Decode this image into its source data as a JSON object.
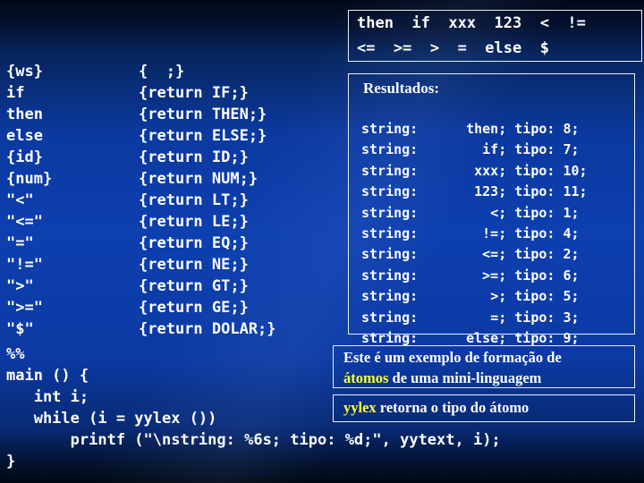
{
  "token_box": {
    "line1": "then  if  xxx  123  <  !=",
    "line2": "<=  >=  >  =  else  $"
  },
  "code_rules": [
    {
      "pattern": "{ws}",
      "action": "{  ;}"
    },
    {
      "pattern": "if",
      "action": "{return IF;}"
    },
    {
      "pattern": "then",
      "action": "{return THEN;}"
    },
    {
      "pattern": "else",
      "action": "{return ELSE;}"
    },
    {
      "pattern": "{id}",
      "action": "{return ID;}"
    },
    {
      "pattern": "{num}",
      "action": "{return NUM;}"
    },
    {
      "pattern": "\"<\"",
      "action": "{return LT;}"
    },
    {
      "pattern": "\"<=\"",
      "action": "{return LE;}"
    },
    {
      "pattern": "\"=\"",
      "action": "{return EQ;}"
    },
    {
      "pattern": "\"!=\"",
      "action": "{return NE;}"
    },
    {
      "pattern": "\">\"",
      "action": "{return GT;}"
    },
    {
      "pattern": "\">=\"",
      "action": "{return GE;}"
    },
    {
      "pattern": "\"$\"",
      "action": "{return DOLAR;}"
    }
  ],
  "code_main": [
    "%%",
    "main () {",
    "   int i;",
    "   while (i = yylex ())",
    "       printf (\"\\nstring: %6s; tipo: %d;\", yytext, i);",
    "}"
  ],
  "results": {
    "title": "Resultados:",
    "label": "string:",
    "type_label": "tipo:",
    "rows": [
      {
        "lexeme": "then",
        "tipo": "8"
      },
      {
        "lexeme": "if",
        "tipo": "7"
      },
      {
        "lexeme": "xxx",
        "tipo": "10"
      },
      {
        "lexeme": "123",
        "tipo": "11"
      },
      {
        "lexeme": "<",
        "tipo": "1"
      },
      {
        "lexeme": "!=",
        "tipo": "4"
      },
      {
        "lexeme": "<=",
        "tipo": "2"
      },
      {
        "lexeme": ">=",
        "tipo": "6"
      },
      {
        "lexeme": ">",
        "tipo": "5"
      },
      {
        "lexeme": "=",
        "tipo": "3"
      },
      {
        "lexeme": "else",
        "tipo": "9"
      }
    ]
  },
  "captions": {
    "caption1_line1": "Este é um exemplo de formação de",
    "caption1_highlight": "átomos",
    "caption1_rest": " de uma mini-linguagem",
    "caption2_highlight": "yylex",
    "caption2_rest": " retorna o tipo do átomo"
  },
  "colors": {
    "highlight": "#ffff33",
    "text": "#ffffff",
    "border": "#e8eef7",
    "background_mid": "#0d3faf"
  }
}
